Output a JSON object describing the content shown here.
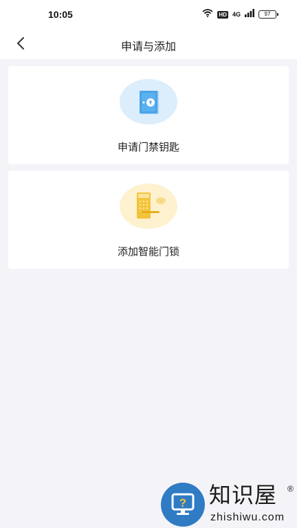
{
  "status_bar": {
    "time": "10:05",
    "hd_badge": "HD",
    "network_label": "4G",
    "battery_level": "97",
    "icons": [
      "wifi-icon",
      "hd-icon",
      "signal-icon",
      "battery-icon"
    ]
  },
  "header": {
    "title": "申请与添加",
    "back_icon": "chevron-left-icon"
  },
  "cards": [
    {
      "label": "申请门禁钥匙",
      "icon": "door-key-icon",
      "circle_color": "#dcedfb",
      "accent_color": "#4aa3e8"
    },
    {
      "label": "添加智能门锁",
      "icon": "smart-lock-icon",
      "circle_color": "#fdf1d0",
      "accent_color": "#f3c43b"
    }
  ],
  "watermark": {
    "title": "知识屋",
    "registered": "®",
    "domain": "zhishiwu.com",
    "logo_icon": "question-monitor-icon",
    "logo_color": "#2f7bc4"
  }
}
